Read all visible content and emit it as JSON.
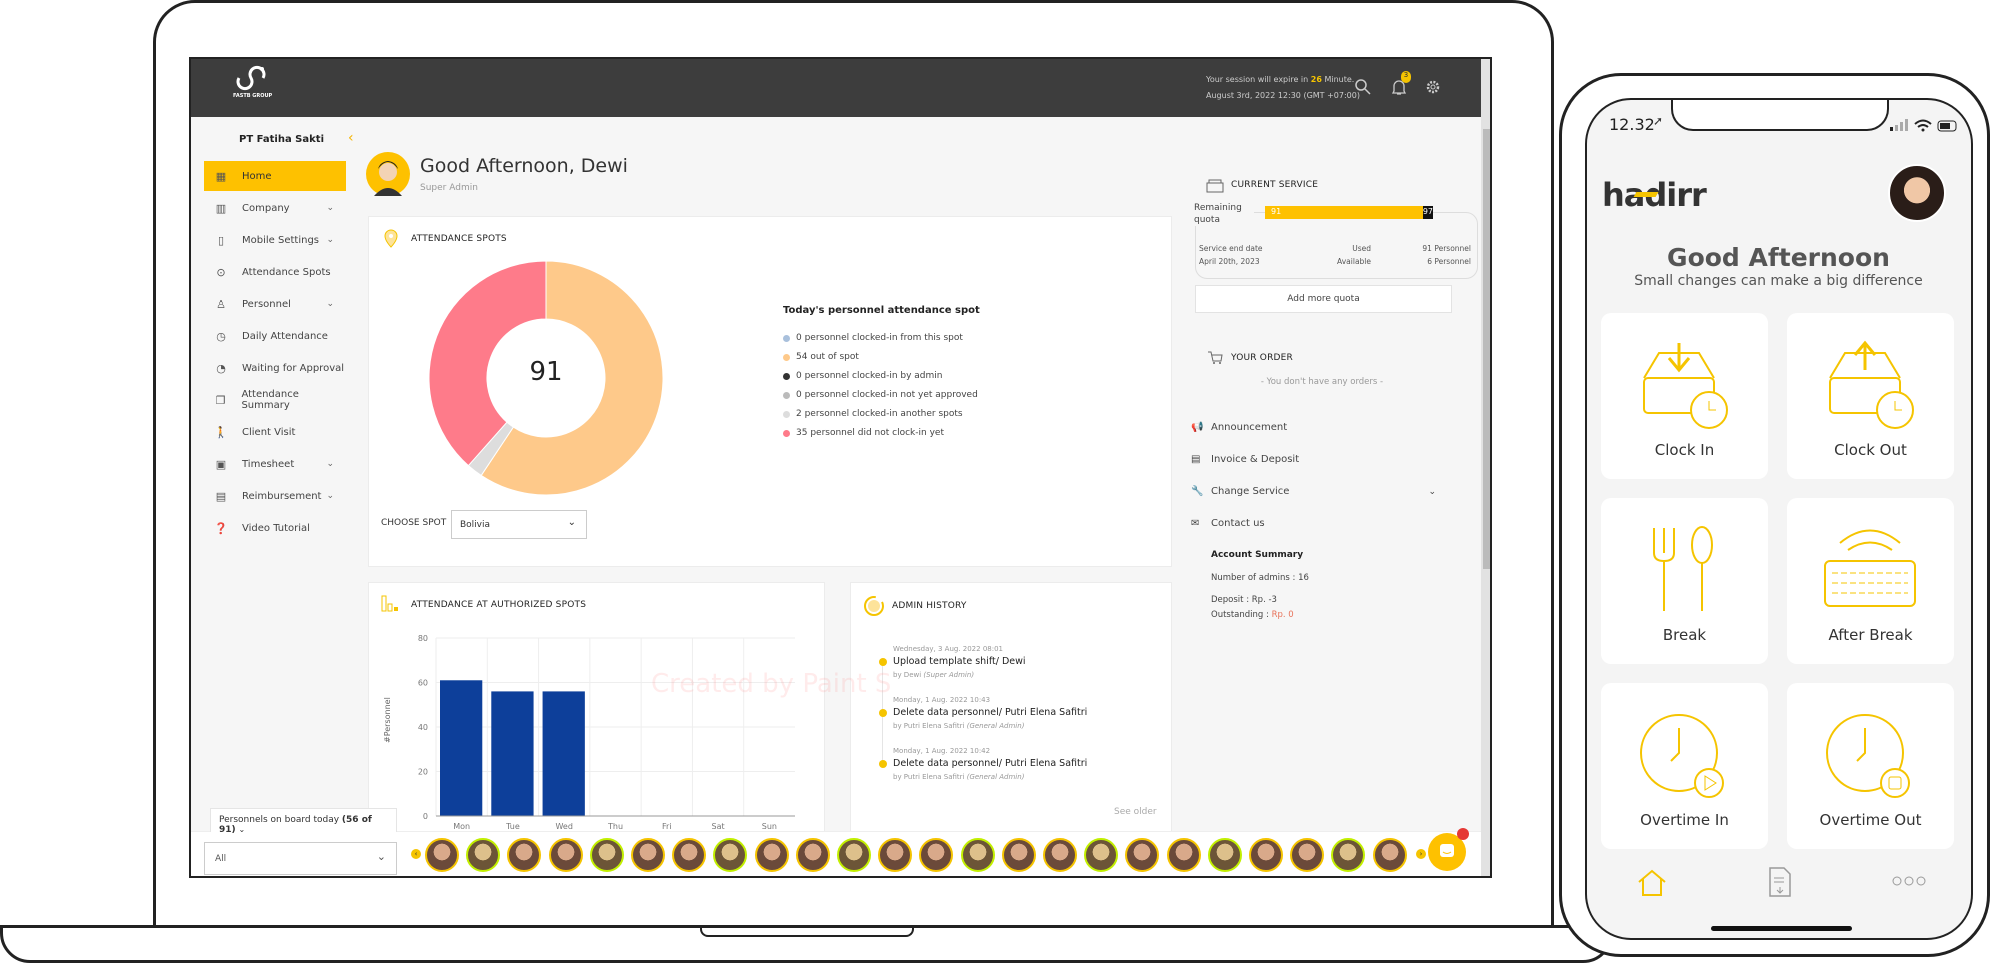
{
  "laptop": {
    "header": {
      "logo_text": "FASTB GROUP",
      "session_prefix": "Your session will expire in",
      "session_minutes": "26",
      "session_suffix": "Minute.",
      "datetime": "August 3rd, 2022 12:30 (GMT +07:00)",
      "notification_count": "3",
      "icons": [
        "search-icon",
        "bell-icon",
        "gear-icon"
      ]
    },
    "sidebar": {
      "company": "PT Fatiha Sakti",
      "items": [
        {
          "label": "Home",
          "icon": "grid-icon",
          "active": true,
          "chevron": false
        },
        {
          "label": "Company",
          "icon": "building-icon",
          "chevron": true
        },
        {
          "label": "Mobile Settings",
          "icon": "phone-icon",
          "chevron": true
        },
        {
          "label": "Attendance Spots",
          "icon": "pin-icon",
          "chevron": false
        },
        {
          "label": "Personnel",
          "icon": "user-icon",
          "chevron": true
        },
        {
          "label": "Daily Attendance",
          "icon": "clock-icon",
          "chevron": false
        },
        {
          "label": "Waiting for Approval",
          "icon": "lock-clock-icon",
          "chevron": false
        },
        {
          "label": "Attendance Summary",
          "icon": "copy-icon",
          "chevron": false
        },
        {
          "label": "Client Visit",
          "icon": "walk-icon",
          "chevron": false
        },
        {
          "label": "Timesheet",
          "icon": "chart-icon",
          "chevron": true
        },
        {
          "label": "Reimbursement",
          "icon": "receipt-icon",
          "chevron": true
        },
        {
          "label": "Video Tutorial",
          "icon": "help-icon",
          "chevron": false
        }
      ]
    },
    "greeting": {
      "title": "Good Afternoon, Dewi",
      "role": "Super Admin"
    },
    "attendance_spots": {
      "title": "ATTENDANCE SPOTS",
      "total": "91",
      "legend_title": "Today's personnel attendance spot",
      "legend": [
        {
          "label": "0 personnel clocked-in from this spot",
          "value": 0,
          "color": "#a9c0dc"
        },
        {
          "label": "54 out of spot",
          "value": 54,
          "color": "#fec98a"
        },
        {
          "label": "0 personnel clocked-in by admin",
          "value": 0,
          "color": "#333333"
        },
        {
          "label": "0 personnel clocked-in not yet approved",
          "value": 0,
          "color": "#bbbbbb"
        },
        {
          "label": "2 personnel clocked-in another spots",
          "value": 2,
          "color": "#dddddd"
        },
        {
          "label": "35  personnel did not clock-in yet",
          "value": 35,
          "color": "#fe7b8a"
        }
      ],
      "choose_spot_label": "CHOOSE SPOT",
      "spot_value": "Bolivia"
    },
    "chart_data": {
      "type": "bar",
      "title": "ATTENDANCE AT AUTHORIZED SPOTS",
      "categories": [
        "Mon",
        "Tue",
        "Wed",
        "Thu",
        "Fri",
        "Sat",
        "Sun"
      ],
      "values": [
        61,
        56,
        56,
        0,
        0,
        0,
        0
      ],
      "ylabel": "#Personnel",
      "xlabel": "",
      "ylim": [
        0,
        80
      ],
      "yticks": [
        "0",
        "20",
        "40",
        "60",
        "80"
      ],
      "grid": true,
      "color": "#0d3f9a"
    },
    "admin_history": {
      "title": "ADMIN HISTORY",
      "items": [
        {
          "date": "Wednesday, 3 Aug. 2022 08:01",
          "action": "Upload template shift/ Dewi",
          "by": "by Dewi",
          "role": "(Super Admin)"
        },
        {
          "date": "Monday, 1 Aug. 2022 10:43",
          "action": "Delete data personnel/ Putri Elena Safitri",
          "by": "by Putri Elena Safitri",
          "role": "(General Admin)"
        },
        {
          "date": "Monday, 1 Aug. 2022 10:42",
          "action": "Delete data personnel/ Putri Elena Safitri",
          "by": "by Putri Elena Safitri",
          "role": "(General Admin)"
        }
      ],
      "see_older": "See older"
    },
    "current_service": {
      "title": "CURRENT SERVICE",
      "remaining_label": "Remaining quota",
      "used_value": "91",
      "total_value": "97",
      "quota_fraction": 0.938,
      "end_label": "Service end date",
      "end_date": "April 20th, 2023",
      "used_label": "Used",
      "used_text": "91 Personnel",
      "available_label": "Available",
      "available_text": "6 Personnel",
      "add_quota": "Add more quota"
    },
    "order": {
      "title": "YOUR ORDER",
      "empty": "- You don't have any orders -"
    },
    "menu": [
      {
        "label": "Announcement",
        "icon": "megaphone-icon"
      },
      {
        "label": "Invoice & Deposit",
        "icon": "invoice-icon"
      },
      {
        "label": "Change Service",
        "icon": "wrench-icon"
      },
      {
        "label": "Contact us",
        "icon": "mail-icon"
      }
    ],
    "account_summary": {
      "title": "Account Summary",
      "admins": "Number of admins : 16",
      "deposit": "Deposit : Rp. -3",
      "outstanding_label": "Outstanding : ",
      "outstanding_value": "Rp. 0"
    },
    "bottom": {
      "onboard_label": "Personnels on board today",
      "onboard_count": "(56 of 91)",
      "filter_value": "All",
      "avatar_count": 24
    },
    "watermark": "Created by Paint S"
  },
  "phone": {
    "time": "12.32",
    "brand": "hadirr",
    "greeting": "Good Afternoon",
    "subtitle": "Small changes can make a big difference",
    "tiles": [
      {
        "label": "Clock In",
        "icon": "clock-in-icon"
      },
      {
        "label": "Clock Out",
        "icon": "clock-out-icon"
      },
      {
        "label": "Break",
        "icon": "cutlery-icon"
      },
      {
        "label": "After Break",
        "icon": "keyboard-icon"
      },
      {
        "label": "Overtime In",
        "icon": "overtime-in-icon"
      },
      {
        "label": "Overtime Out",
        "icon": "overtime-out-icon"
      }
    ],
    "nav": [
      "home-icon",
      "document-icon",
      "more-icon"
    ],
    "accent": "#f5c400"
  }
}
